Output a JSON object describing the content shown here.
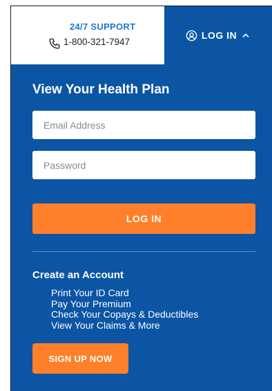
{
  "header": {
    "support_title": "24/7 SUPPORT",
    "support_phone": "1-800-321-7947",
    "login_toggle_label": "LOG IN"
  },
  "icons": {
    "phone": "phone-icon",
    "user": "user-circle-icon",
    "toggle": "chevron-up-icon"
  },
  "login_panel": {
    "title": "View Your Health Plan",
    "email_placeholder": "Email Address",
    "email_value": "",
    "password_placeholder": "Password",
    "password_value": "",
    "login_button_label": "LOG IN"
  },
  "create_account": {
    "title": "Create an Account",
    "items": [
      "Print Your ID Card",
      "Pay Your Premium",
      "Check Your Copays & Deductibles",
      "View Your Claims & More"
    ],
    "signup_button_label": "SIGN UP NOW"
  },
  "colors": {
    "panel_background": "#0b55a4",
    "accent_orange": "#ff7f2a",
    "support_blue": "#1f78c8"
  }
}
